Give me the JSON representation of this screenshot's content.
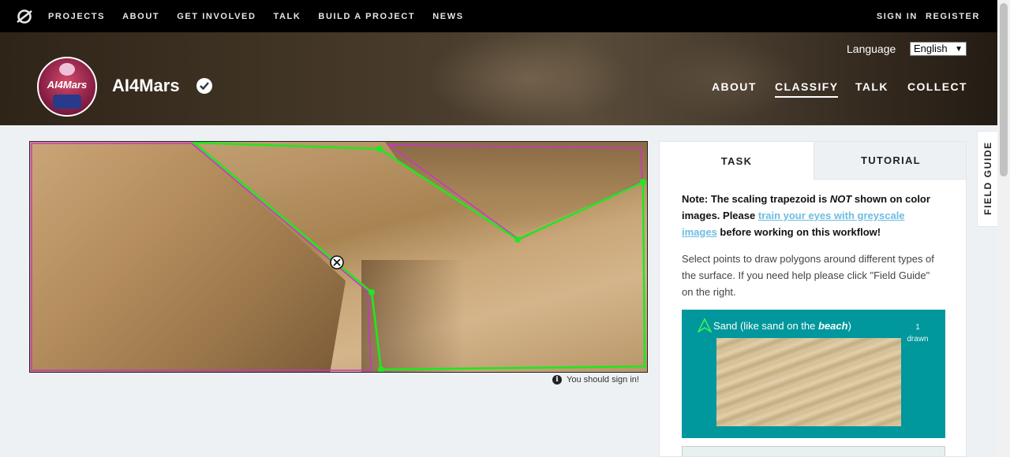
{
  "topnav": {
    "links": [
      "PROJECTS",
      "ABOUT",
      "GET INVOLVED",
      "TALK",
      "BUILD A PROJECT",
      "NEWS"
    ],
    "sign_in": "SIGN IN",
    "register": "REGISTER"
  },
  "project": {
    "title": "AI4Mars",
    "avatar_text": "AI4Mars",
    "language_label": "Language",
    "language_value": "English",
    "nav": [
      "ABOUT",
      "CLASSIFY",
      "TALK",
      "COLLECT"
    ],
    "active_nav": "CLASSIFY"
  },
  "subject": {
    "signin_note": "You should sign in!"
  },
  "panel": {
    "tabs": [
      "TASK",
      "TUTORIAL"
    ],
    "note_prefix": "Note: The scaling trapezoid is ",
    "note_not": "NOT",
    "note_mid": " shown on color images. Please ",
    "note_link": "train your eyes with greyscale images",
    "note_suffix": " before working on this workflow!",
    "instructions": "Select points to draw polygons around different types of the surface. If you need help please click \"Field Guide\" on the right.",
    "tool": {
      "label_prefix": "Sand (like sand on the ",
      "label_em": "beach",
      "label_suffix": ")",
      "count_num": "1",
      "count_word": "drawn"
    }
  },
  "field_guide": "FIELD GUIDE",
  "colors": {
    "accent_teal": "#00979d",
    "polygon_green": "#22e622",
    "polygon_magenta": "#cc33cc",
    "link_blue": "#6bbde0"
  }
}
